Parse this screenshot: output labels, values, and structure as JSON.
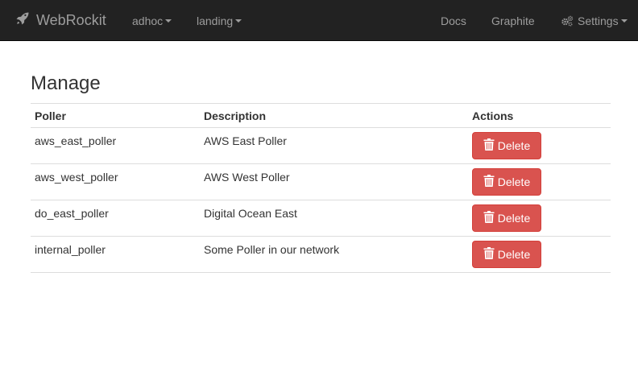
{
  "navbar": {
    "brand": "WebRockit",
    "brand_icon": "rocket-icon",
    "menus": [
      {
        "label": "adhoc",
        "has_caret": true
      },
      {
        "label": "landing",
        "has_caret": true
      }
    ],
    "right_links": [
      {
        "label": "Docs"
      },
      {
        "label": "Graphite"
      },
      {
        "label": "Settings",
        "icon": "gears-icon",
        "has_caret": true
      }
    ],
    "background": "#222222",
    "link_color": "#9d9d9d"
  },
  "page": {
    "title": "Manage"
  },
  "table": {
    "headers": [
      "Poller",
      "Description",
      "Actions"
    ],
    "rows": [
      {
        "poller": "aws_east_poller",
        "description": "AWS East Poller",
        "action": "Delete"
      },
      {
        "poller": "aws_west_poller",
        "description": "AWS West Poller",
        "action": "Delete"
      },
      {
        "poller": "do_east_poller",
        "description": "Digital Ocean East",
        "action": "Delete"
      },
      {
        "poller": "internal_poller",
        "description": "Some Poller in our network",
        "action": "Delete"
      }
    ],
    "delete_color": "#d9534f",
    "action_icon": "trash-icon"
  }
}
